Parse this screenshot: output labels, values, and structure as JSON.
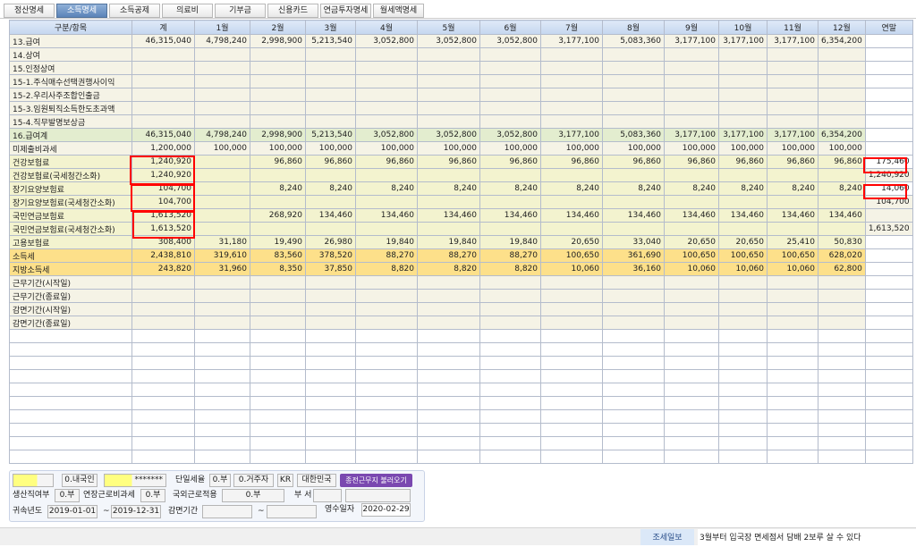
{
  "tabs": [
    "정산명세",
    "소득명세",
    "소득공제",
    "의료비",
    "기부금",
    "신용카드",
    "연금투자명세",
    "월세액명세"
  ],
  "active_tab": 1,
  "columns": [
    "구분/항목",
    "계",
    "1월",
    "2월",
    "3월",
    "4월",
    "5월",
    "6월",
    "7월",
    "8월",
    "9월",
    "10월",
    "11월",
    "12월",
    "연말"
  ],
  "rows": [
    {
      "label": "13.급여",
      "style": "beige",
      "values": [
        "46,315,040",
        "4,798,240",
        "2,998,900",
        "5,213,540",
        "3,052,800",
        "3,052,800",
        "3,052,800",
        "3,177,100",
        "5,083,360",
        "3,177,100",
        "3,177,100",
        "3,177,100",
        "6,354,200",
        ""
      ]
    },
    {
      "label": "14.상여",
      "style": "beige",
      "values": [
        "",
        "",
        "",
        "",
        "",
        "",
        "",
        "",
        "",
        "",
        "",
        "",
        "",
        ""
      ]
    },
    {
      "label": "15.인정상여",
      "style": "beige",
      "values": [
        "",
        "",
        "",
        "",
        "",
        "",
        "",
        "",
        "",
        "",
        "",
        "",
        "",
        ""
      ]
    },
    {
      "label": "15-1.주식매수선택권행사이익",
      "style": "beige",
      "values": [
        "",
        "",
        "",
        "",
        "",
        "",
        "",
        "",
        "",
        "",
        "",
        "",
        "",
        ""
      ]
    },
    {
      "label": "15-2.우리사주조합인출금",
      "style": "beige",
      "values": [
        "",
        "",
        "",
        "",
        "",
        "",
        "",
        "",
        "",
        "",
        "",
        "",
        "",
        ""
      ]
    },
    {
      "label": "15-3.임원퇴직소득한도초과액",
      "style": "beige",
      "values": [
        "",
        "",
        "",
        "",
        "",
        "",
        "",
        "",
        "",
        "",
        "",
        "",
        "",
        ""
      ]
    },
    {
      "label": "15-4.직무발명보상금",
      "style": "beige",
      "values": [
        "",
        "",
        "",
        "",
        "",
        "",
        "",
        "",
        "",
        "",
        "",
        "",
        "",
        ""
      ]
    },
    {
      "label": "16.급여계",
      "style": "green",
      "values": [
        "46,315,040",
        "4,798,240",
        "2,998,900",
        "5,213,540",
        "3,052,800",
        "3,052,800",
        "3,052,800",
        "3,177,100",
        "5,083,360",
        "3,177,100",
        "3,177,100",
        "3,177,100",
        "6,354,200",
        ""
      ]
    },
    {
      "label": "미제출비과세",
      "style": "beige",
      "values": [
        "1,200,000",
        "100,000",
        "100,000",
        "100,000",
        "100,000",
        "100,000",
        "100,000",
        "100,000",
        "100,000",
        "100,000",
        "100,000",
        "100,000",
        "100,000",
        ""
      ]
    },
    {
      "label": "건강보험료",
      "style": "yel",
      "values": [
        "1,240,920",
        "",
        "96,860",
        "96,860",
        "96,860",
        "96,860",
        "96,860",
        "96,860",
        "96,860",
        "96,860",
        "96,860",
        "96,860",
        "96,860",
        "175,460"
      ]
    },
    {
      "label": "건강보험료(국세청간소화)",
      "style": "yel",
      "values": [
        "1,240,920",
        "",
        "",
        "",
        "",
        "",
        "",
        "",
        "",
        "",
        "",
        "",
        "",
        "1,240,920"
      ]
    },
    {
      "label": "장기요양보험료",
      "style": "yel",
      "values": [
        "104,700",
        "",
        "8,240",
        "8,240",
        "8,240",
        "8,240",
        "8,240",
        "8,240",
        "8,240",
        "8,240",
        "8,240",
        "8,240",
        "8,240",
        "14,060"
      ]
    },
    {
      "label": "장기요양보험료(국세청간소화)",
      "style": "yel",
      "values": [
        "104,700",
        "",
        "",
        "",
        "",
        "",
        "",
        "",
        "",
        "",
        "",
        "",
        "",
        "104,700"
      ]
    },
    {
      "label": "국민연금보험료",
      "style": "yel",
      "values": [
        "1,613,520",
        "",
        "268,920",
        "134,460",
        "134,460",
        "134,460",
        "134,460",
        "134,460",
        "134,460",
        "134,460",
        "134,460",
        "134,460",
        "134,460",
        ""
      ]
    },
    {
      "label": "국민연금보험료(국세청간소화)",
      "style": "yel",
      "values": [
        "1,613,520",
        "",
        "",
        "",
        "",
        "",
        "",
        "",
        "",
        "",
        "",
        "",
        "",
        "1,613,520"
      ]
    },
    {
      "label": "고용보험료",
      "style": "yel",
      "values": [
        "308,400",
        "31,180",
        "19,490",
        "26,980",
        "19,840",
        "19,840",
        "19,840",
        "20,650",
        "33,040",
        "20,650",
        "20,650",
        "25,410",
        "50,830",
        ""
      ]
    },
    {
      "label": "소득세",
      "style": "tax",
      "values": [
        "2,438,810",
        "319,610",
        "83,560",
        "378,520",
        "88,270",
        "88,270",
        "88,270",
        "100,650",
        "361,690",
        "100,650",
        "100,650",
        "100,650",
        "628,020",
        ""
      ]
    },
    {
      "label": "지방소득세",
      "style": "tax",
      "values": [
        "243,820",
        "31,960",
        "8,350",
        "37,850",
        "8,820",
        "8,820",
        "8,820",
        "10,060",
        "36,160",
        "10,060",
        "10,060",
        "10,060",
        "62,800",
        ""
      ]
    },
    {
      "label": "근무기간(시작일)",
      "style": "beige",
      "values": [
        "",
        "",
        "",
        "",
        "",
        "",
        "",
        "",
        "",
        "",
        "",
        "",
        "",
        ""
      ]
    },
    {
      "label": "근무기간(종료일)",
      "style": "beige",
      "values": [
        "",
        "",
        "",
        "",
        "",
        "",
        "",
        "",
        "",
        "",
        "",
        "",
        "",
        ""
      ]
    },
    {
      "label": "감면기간(시작일)",
      "style": "beige",
      "values": [
        "",
        "",
        "",
        "",
        "",
        "",
        "",
        "",
        "",
        "",
        "",
        "",
        "",
        ""
      ]
    },
    {
      "label": "감면기간(종료일)",
      "style": "beige",
      "values": [
        "",
        "",
        "",
        "",
        "",
        "",
        "",
        "",
        "",
        "",
        "",
        "",
        "",
        ""
      ]
    }
  ],
  "panel": {
    "nationality": "0.내국인",
    "masked_id": "*******",
    "single_rate_label": "단일세율",
    "single_rate": "0.부",
    "residence": "0.거주자",
    "country_code": "KR",
    "country": "대한민국",
    "load_prev_button": "종전근무지 불러오기",
    "production_label": "생산직여부",
    "production": "0.부",
    "overtime_label": "연장근로비과세",
    "overtime": "0.부",
    "foreign_label": "국외근로적용",
    "foreign": "0.부",
    "dept_label": "부 서",
    "year_label": "귀속년도",
    "year_from": "2019-01-01",
    "tilde": "~",
    "year_to": "2019-12-31",
    "reduction_label": "감면기간",
    "receipt_label": "영수일자",
    "receipt_date": "2020-02-29"
  },
  "status": {
    "news_label": "조세일보",
    "news_text": "3월부터 입국장 면세점서 담배 2보루 살 수 있다"
  },
  "colors": {
    "highlight": "#ff0000",
    "tab_active": "#5b83b8",
    "button": "#7a48b0"
  }
}
